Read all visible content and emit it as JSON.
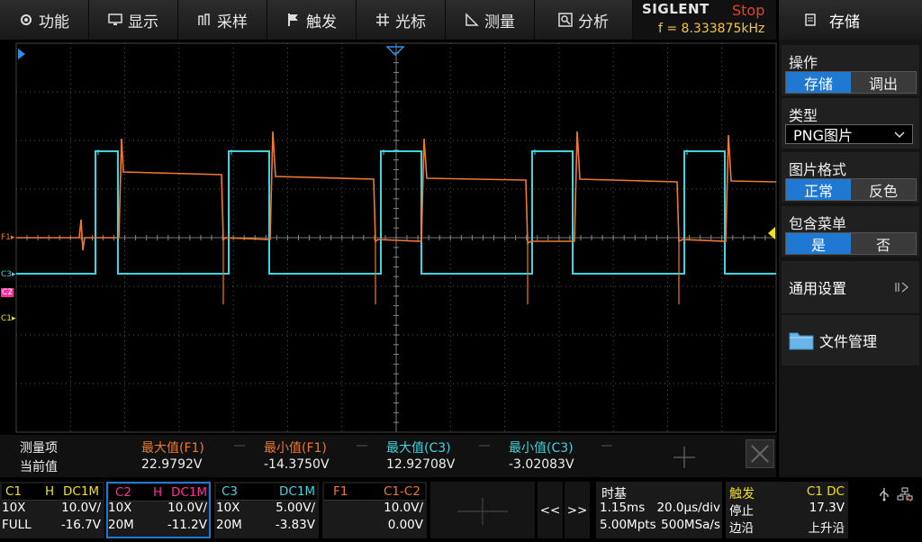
{
  "menu": {
    "items": [
      {
        "label": "功能",
        "icon": "gear-icon"
      },
      {
        "label": "显示",
        "icon": "monitor-icon"
      },
      {
        "label": "采样",
        "icon": "sample-icon"
      },
      {
        "label": "触发",
        "icon": "flag-icon"
      },
      {
        "label": "光标",
        "icon": "cursor-icon"
      },
      {
        "label": "测量",
        "icon": "measure-icon"
      },
      {
        "label": "分析",
        "icon": "analyze-icon"
      }
    ],
    "brand": "SIGLENT",
    "run_state": "Stop",
    "frequency": "f = 8.333875kHz"
  },
  "side_menu": {
    "title": "存储",
    "operation": {
      "label": "操作",
      "options": [
        "存储",
        "调出"
      ],
      "selected": 0
    },
    "type": {
      "label": "类型",
      "value": "PNG图片"
    },
    "image_format": {
      "label": "图片格式",
      "options": [
        "正常",
        "反色"
      ],
      "selected": 0
    },
    "include_menu": {
      "label": "包含菜单",
      "options": [
        "是",
        "否"
      ],
      "selected": 0
    },
    "general_settings": "通用设置",
    "file_manager": "文件管理"
  },
  "markers": {
    "f1": "F1",
    "c3": "C3",
    "c2": "C2",
    "c1": "C1"
  },
  "colors": {
    "c1": "#f0e020",
    "c2": "#ff2fa0",
    "c3": "#3fd5e0",
    "f1": "#f07830",
    "accent": "#1f78d1"
  },
  "measurements": {
    "header_label": "测量项",
    "row_label": "当前值",
    "items": [
      {
        "name": "最大值(F1)",
        "value": "22.9792V",
        "color": "#f07830"
      },
      {
        "name": "最小值(F1)",
        "value": "-14.3750V",
        "color": "#f07830"
      },
      {
        "name": "最大值(C3)",
        "value": "12.92708V",
        "color": "#3fd5e0"
      },
      {
        "name": "最小值(C3)",
        "value": "-3.02083V",
        "color": "#3fd5e0"
      }
    ]
  },
  "channels": [
    {
      "name": "C1",
      "mode": "H",
      "coupling": "DC1M",
      "probe": "10X",
      "scale": "10.0V/",
      "bw": "FULL",
      "offset": "-16.7V"
    },
    {
      "name": "C2",
      "mode": "H",
      "coupling": "DC1M",
      "probe": "10X",
      "scale": "10.0V/",
      "bw": "20M",
      "offset": "-11.2V"
    },
    {
      "name": "C3",
      "mode": "",
      "coupling": "DC1M",
      "probe": "10X",
      "scale": "5.00V/",
      "bw": "20M",
      "offset": "-3.83V"
    }
  ],
  "math": {
    "name": "F1",
    "expr": "C1-C2",
    "scale": "10.0V/",
    "offset": "0.00V"
  },
  "nav": {
    "prev": "<<",
    "next": ">>"
  },
  "timebase": {
    "label": "时基",
    "delay": "1.15ms",
    "scale": "20.0μs/div",
    "memory": "5.00Mpts",
    "rate": "500MSa/s"
  },
  "trigger": {
    "label": "触发",
    "source": "C1 DC",
    "state": "停止",
    "level": "17.3V",
    "type": "边沿",
    "slope": "上升沿"
  }
}
